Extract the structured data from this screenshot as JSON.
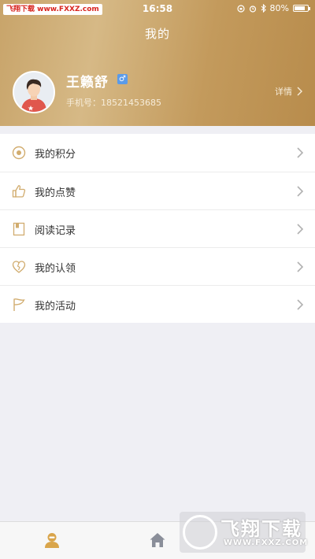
{
  "status_bar": {
    "watermark": "飞翔下载 www.FXXZ.com",
    "time": "16:58",
    "battery": "80%",
    "battery_level": 0.8
  },
  "header": {
    "title": "我的",
    "user_name": "王籁舒",
    "gender_symbol": "♂",
    "phone": "手机号：18521453685",
    "details_label": "详情"
  },
  "menu": {
    "items": [
      {
        "label": "我的积分",
        "icon": "points-icon"
      },
      {
        "label": "我的点赞",
        "icon": "thumbs-up-icon"
      },
      {
        "label": "阅读记录",
        "icon": "book-icon"
      },
      {
        "label": "我的认领",
        "icon": "heart-icon"
      },
      {
        "label": "我的活动",
        "icon": "flag-icon"
      }
    ]
  },
  "watermark_br": {
    "main": "飞翔下载",
    "sub": "WWW.FXXZ.COM"
  },
  "colors": {
    "accent": "#c9a466",
    "tab_active": "#d9a54b",
    "tab_inactive": "#8a8e99"
  }
}
